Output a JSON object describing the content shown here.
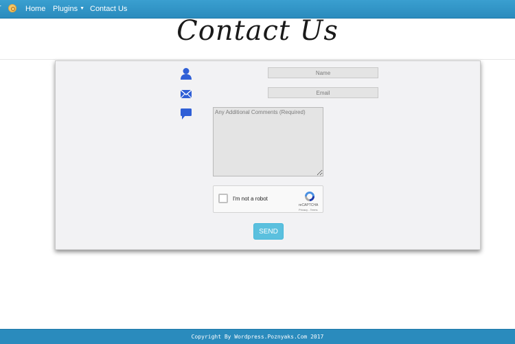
{
  "nav": {
    "brand_tail": "r",
    "items": [
      {
        "label": "Home"
      },
      {
        "label": "Plugins",
        "icon": "caret-down-icon"
      },
      {
        "label": "Contact Us"
      }
    ]
  },
  "page": {
    "title": "Contact Us"
  },
  "form": {
    "name_placeholder": "Name",
    "email_placeholder": "Email",
    "comments_placeholder": "Any Additional Comments (Required)",
    "icons": [
      "user-icon",
      "envelope-icon",
      "speech-bubble-icon"
    ],
    "icon_color": "#2f5fd6",
    "send_label": "SEND",
    "send_color": "#5bc0de"
  },
  "recaptcha": {
    "label": "I'm not a robot",
    "brand": "reCAPTCHA",
    "terms": "Privacy - Terms"
  },
  "footer": {
    "text": "Copyright By Wordpress.Poznyaks.Com 2017"
  },
  "colors": {
    "nav_bg": "#2a8bbd"
  }
}
